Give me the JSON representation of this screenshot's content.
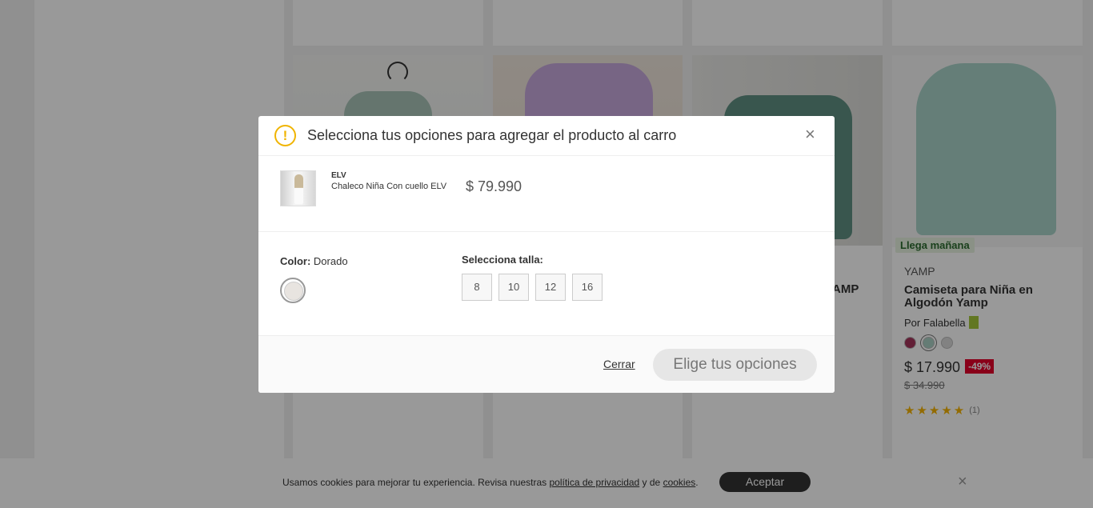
{
  "product_card": {
    "badge": "Llega mañana",
    "brand": "YAMP",
    "title": "Camiseta para Niña en Algodón Yamp",
    "seller": "Por Falabella",
    "swatches": [
      "#a3355b",
      "#a8cfc3",
      "#d9d9d9"
    ],
    "price": "$ 17.990",
    "discount": "-49%",
    "old_price": "$ 34.990",
    "rating_stars": "★★★★★",
    "rating_count": "(1)"
  },
  "partial_card_title": "AMP",
  "cookie_bar": {
    "text_before": "Usamos cookies para mejorar tu experiencia. Revisa nuestras ",
    "privacy_link": "política de privacidad",
    "text_middle": " y de ",
    "cookies_link": "cookies",
    "text_end": ".",
    "accept_label": "Aceptar",
    "close_icon": "×"
  },
  "modal": {
    "warning_icon": "!",
    "title": "Selecciona tus opciones para agregar el producto al carro",
    "close_icon": "×",
    "product": {
      "brand": "ELV",
      "name": "Chaleco Niña Con cuello ELV",
      "price": "$ 79.990"
    },
    "color": {
      "label": "Color:",
      "value": "Dorado"
    },
    "size": {
      "label": "Selecciona talla:",
      "options": [
        "8",
        "10",
        "12",
        "16"
      ]
    },
    "cerrar_label": "Cerrar",
    "submit_label": "Elige tus opciones"
  }
}
